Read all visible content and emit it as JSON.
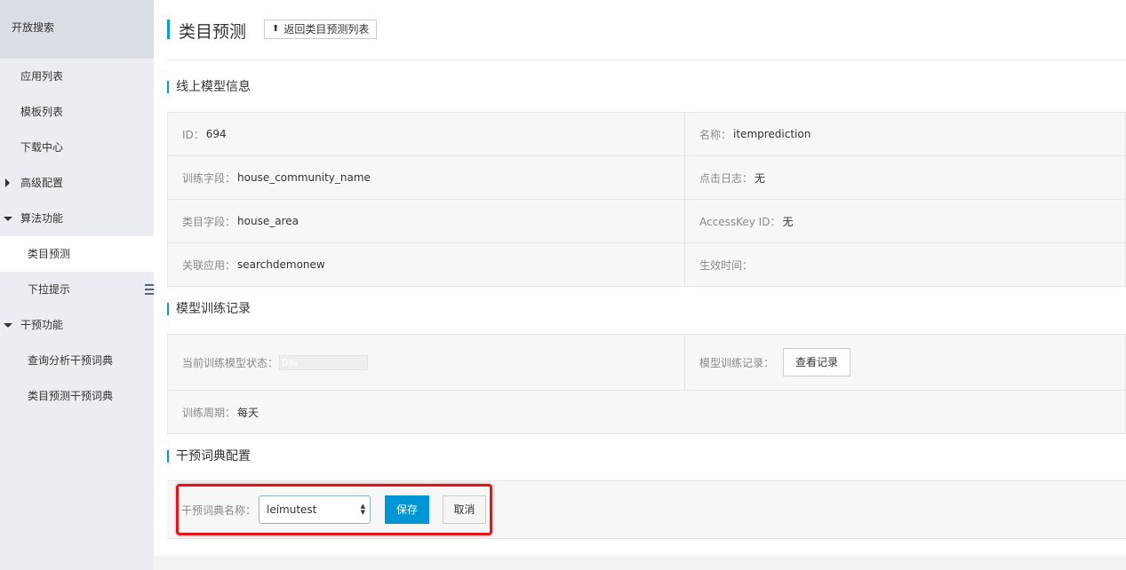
{
  "sidebar": {
    "brand": "开放搜索",
    "items": [
      {
        "label": "应用列表"
      },
      {
        "label": "模板列表"
      },
      {
        "label": "下载中心"
      },
      {
        "label": "高级配置"
      },
      {
        "label": "算法功能"
      },
      {
        "label": "类目预测"
      },
      {
        "label": "下拉提示"
      },
      {
        "label": "干预功能"
      },
      {
        "label": "查询分析干预词典"
      },
      {
        "label": "类目预测干预词典"
      }
    ]
  },
  "header": {
    "title": "类目预测",
    "back_button": "返回类目预测列表"
  },
  "model_info": {
    "title": "线上模型信息",
    "id_label": "ID：",
    "id_value": "694",
    "name_label": "名称：",
    "name_value": "itemprediction",
    "train_field_label": "训练字段：",
    "train_field_value": "house_community_name",
    "click_log_label": "点击日志：",
    "click_log_value": "无",
    "category_field_label": "类目字段：",
    "category_field_value": "house_area",
    "accesskey_label": "AccessKey ID：",
    "accesskey_value": "无",
    "linked_app_label": "关联应用：",
    "linked_app_value": "searchdemonew",
    "effective_time_label": "生效时间："
  },
  "training": {
    "title": "模型训练记录",
    "status_label": "当前训练模型状态：",
    "progress_text": "0%",
    "progress_value": 0,
    "records_label": "模型训练记录：",
    "records_button": "查看记录",
    "period_label": "训练周期：",
    "period_value": "每天"
  },
  "dict": {
    "title": "干预词典配置",
    "name_label": "干预词典名称：",
    "selected": "leimutest",
    "save": "保存",
    "cancel": "取消"
  },
  "colors": {
    "accent": "#00a2ca",
    "primary_button": "#0096d6",
    "highlight": "#e0161b"
  }
}
